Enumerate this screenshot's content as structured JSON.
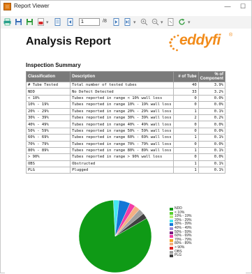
{
  "window": {
    "title": "Report Viewer",
    "minimize_symbol": "—",
    "maximize_symbol": "☐"
  },
  "toolbar": {
    "page_value": "1",
    "page_total": "/8",
    "icons": [
      "print-icon",
      "save-icon",
      "save-icon",
      "export-pdf-icon",
      "page-icon",
      "page-icon",
      "first-page-icon",
      "last-page-icon",
      "page-icon",
      "zoom-in-icon",
      "zoom-out-icon",
      "page-icon",
      "refresh-icon"
    ]
  },
  "report": {
    "title": "Analysis Report",
    "logo_text": "eddyfi",
    "logo_reg": "®",
    "section_title": "Inspection Summary",
    "brand_color": "#f28c1b"
  },
  "table": {
    "headers": [
      "Classification",
      "Description",
      "# of Tube",
      "% of Component"
    ],
    "rows": [
      [
        "# Tube Tested",
        "Total number of tested tubes",
        "40",
        "3.9%"
      ],
      [
        "NDD",
        "No Defect Detected",
        "33",
        "3.2%"
      ],
      [
        "< 10%",
        "Tubes reported in range < 10% wall loss",
        "0",
        "0.0%"
      ],
      [
        "10% - 19%",
        "Tubes reported in range 10% - 19% wall loss",
        "0",
        "0.0%"
      ],
      [
        "20% - 29%",
        "Tubes reported in range 20% - 29% wall loss",
        "1",
        "0.1%"
      ],
      [
        "30% - 39%",
        "Tubes reported in range 30% - 39% wall loss",
        "2",
        "0.2%"
      ],
      [
        "40% - 49%",
        "Tubes reported in range 40% - 49% wall loss",
        "0",
        "0.0%"
      ],
      [
        "50% - 59%",
        "Tubes reported in range 50% - 59% wall loss",
        "0",
        "0.0%"
      ],
      [
        "60% - 69%",
        "Tubes reported in range 60% - 69% wall loss",
        "1",
        "0.1%"
      ],
      [
        "70% - 79%",
        "Tubes reported in range 70% - 79% wall loss",
        "0",
        "0.0%"
      ],
      [
        "80% - 89%",
        "Tubes reported in range 80% - 89% wall loss",
        "1",
        "0.1%"
      ],
      [
        "> 90%",
        "Tubes reported in range > 90% wall loss",
        "0",
        "0.0%"
      ],
      [
        "OBS",
        "Obstructed",
        "1",
        "0.1%"
      ],
      [
        "PLG",
        "Plugged",
        "1",
        "0.1%"
      ]
    ]
  },
  "chart_data": {
    "type": "pie",
    "categories": [
      "NDD",
      "< 10%",
      "10% - 19%",
      "20% - 29%",
      "30% - 39%",
      "40% - 49%",
      "50% - 59%",
      "60% - 69%",
      "70% - 79%",
      "80% - 89%",
      "> 90%",
      "OBS",
      "PLG"
    ],
    "values": [
      33,
      0,
      0,
      1,
      2,
      0,
      0,
      1,
      0,
      1,
      0,
      1,
      1
    ],
    "colors": [
      "#0f9a16",
      "#57d12c",
      "#b3f07a",
      "#44e6f2",
      "#1577d6",
      "#9a8ad8",
      "#7a1c80",
      "#f23ca6",
      "#f5a623",
      "#f4b183",
      "#e02020",
      "#a0a0a0",
      "#404040"
    ],
    "legend": [
      "NDD",
      "< 10%",
      "10% - 19%",
      "20% - 29%",
      "30% - 39%",
      "40% - 49%",
      "50% - 59%",
      "60% - 69%",
      "70% - 79%",
      "80% - 89%",
      "> 90%",
      "OBS",
      "PLG"
    ],
    "legend_position": "right"
  }
}
